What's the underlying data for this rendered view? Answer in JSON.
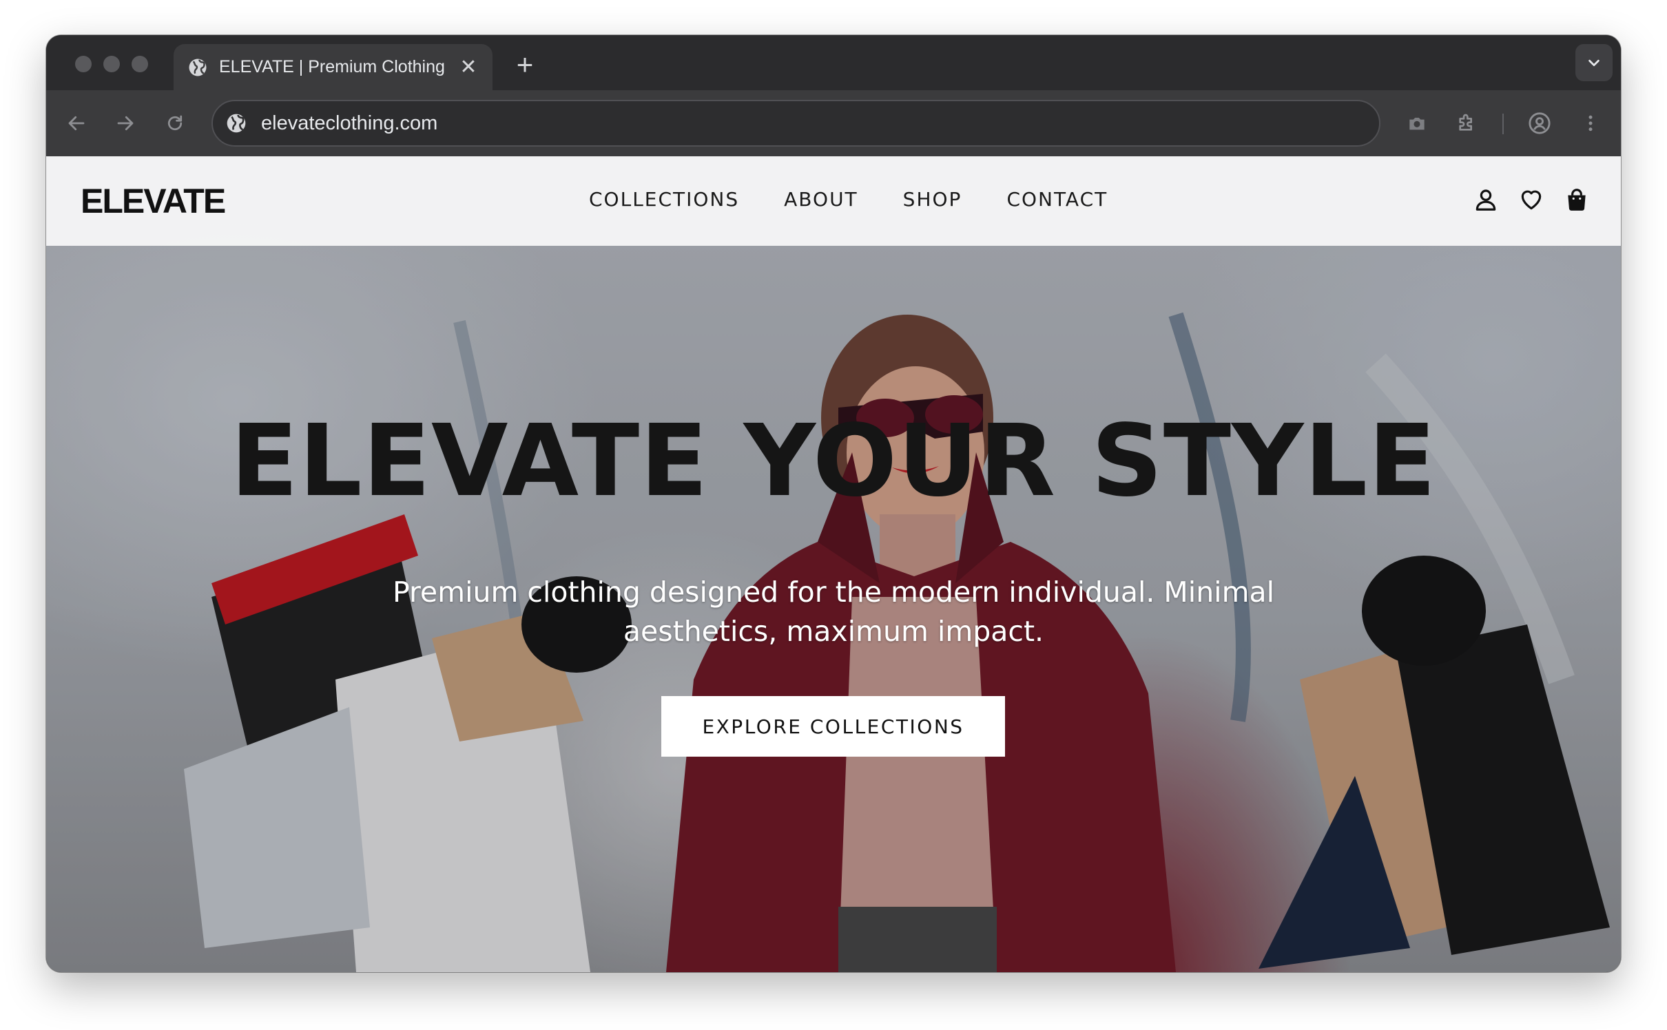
{
  "browser": {
    "tab_title": "ELEVATE | Premium Clothing",
    "tab_close": "✕",
    "new_tab": "+",
    "url": "elevateclothing.com"
  },
  "site": {
    "logo": "ELEVATE",
    "nav": [
      "COLLECTIONS",
      "ABOUT",
      "SHOP",
      "CONTACT"
    ],
    "icons": [
      "user-icon",
      "heart-icon",
      "shopping-bag-icon"
    ]
  },
  "hero": {
    "title": "ELEVATE YOUR STYLE",
    "subtitle": "Premium clothing designed for the modern individual. Minimal aesthetics, maximum impact.",
    "cta_label": "EXPLORE COLLECTIONS"
  },
  "colors": {
    "browser_chrome": "#2b2b2d",
    "toolbar": "#3b3b3d",
    "header_bg": "#f6f6f6",
    "text_dark": "#151515",
    "coat_red": "#7a1422"
  }
}
